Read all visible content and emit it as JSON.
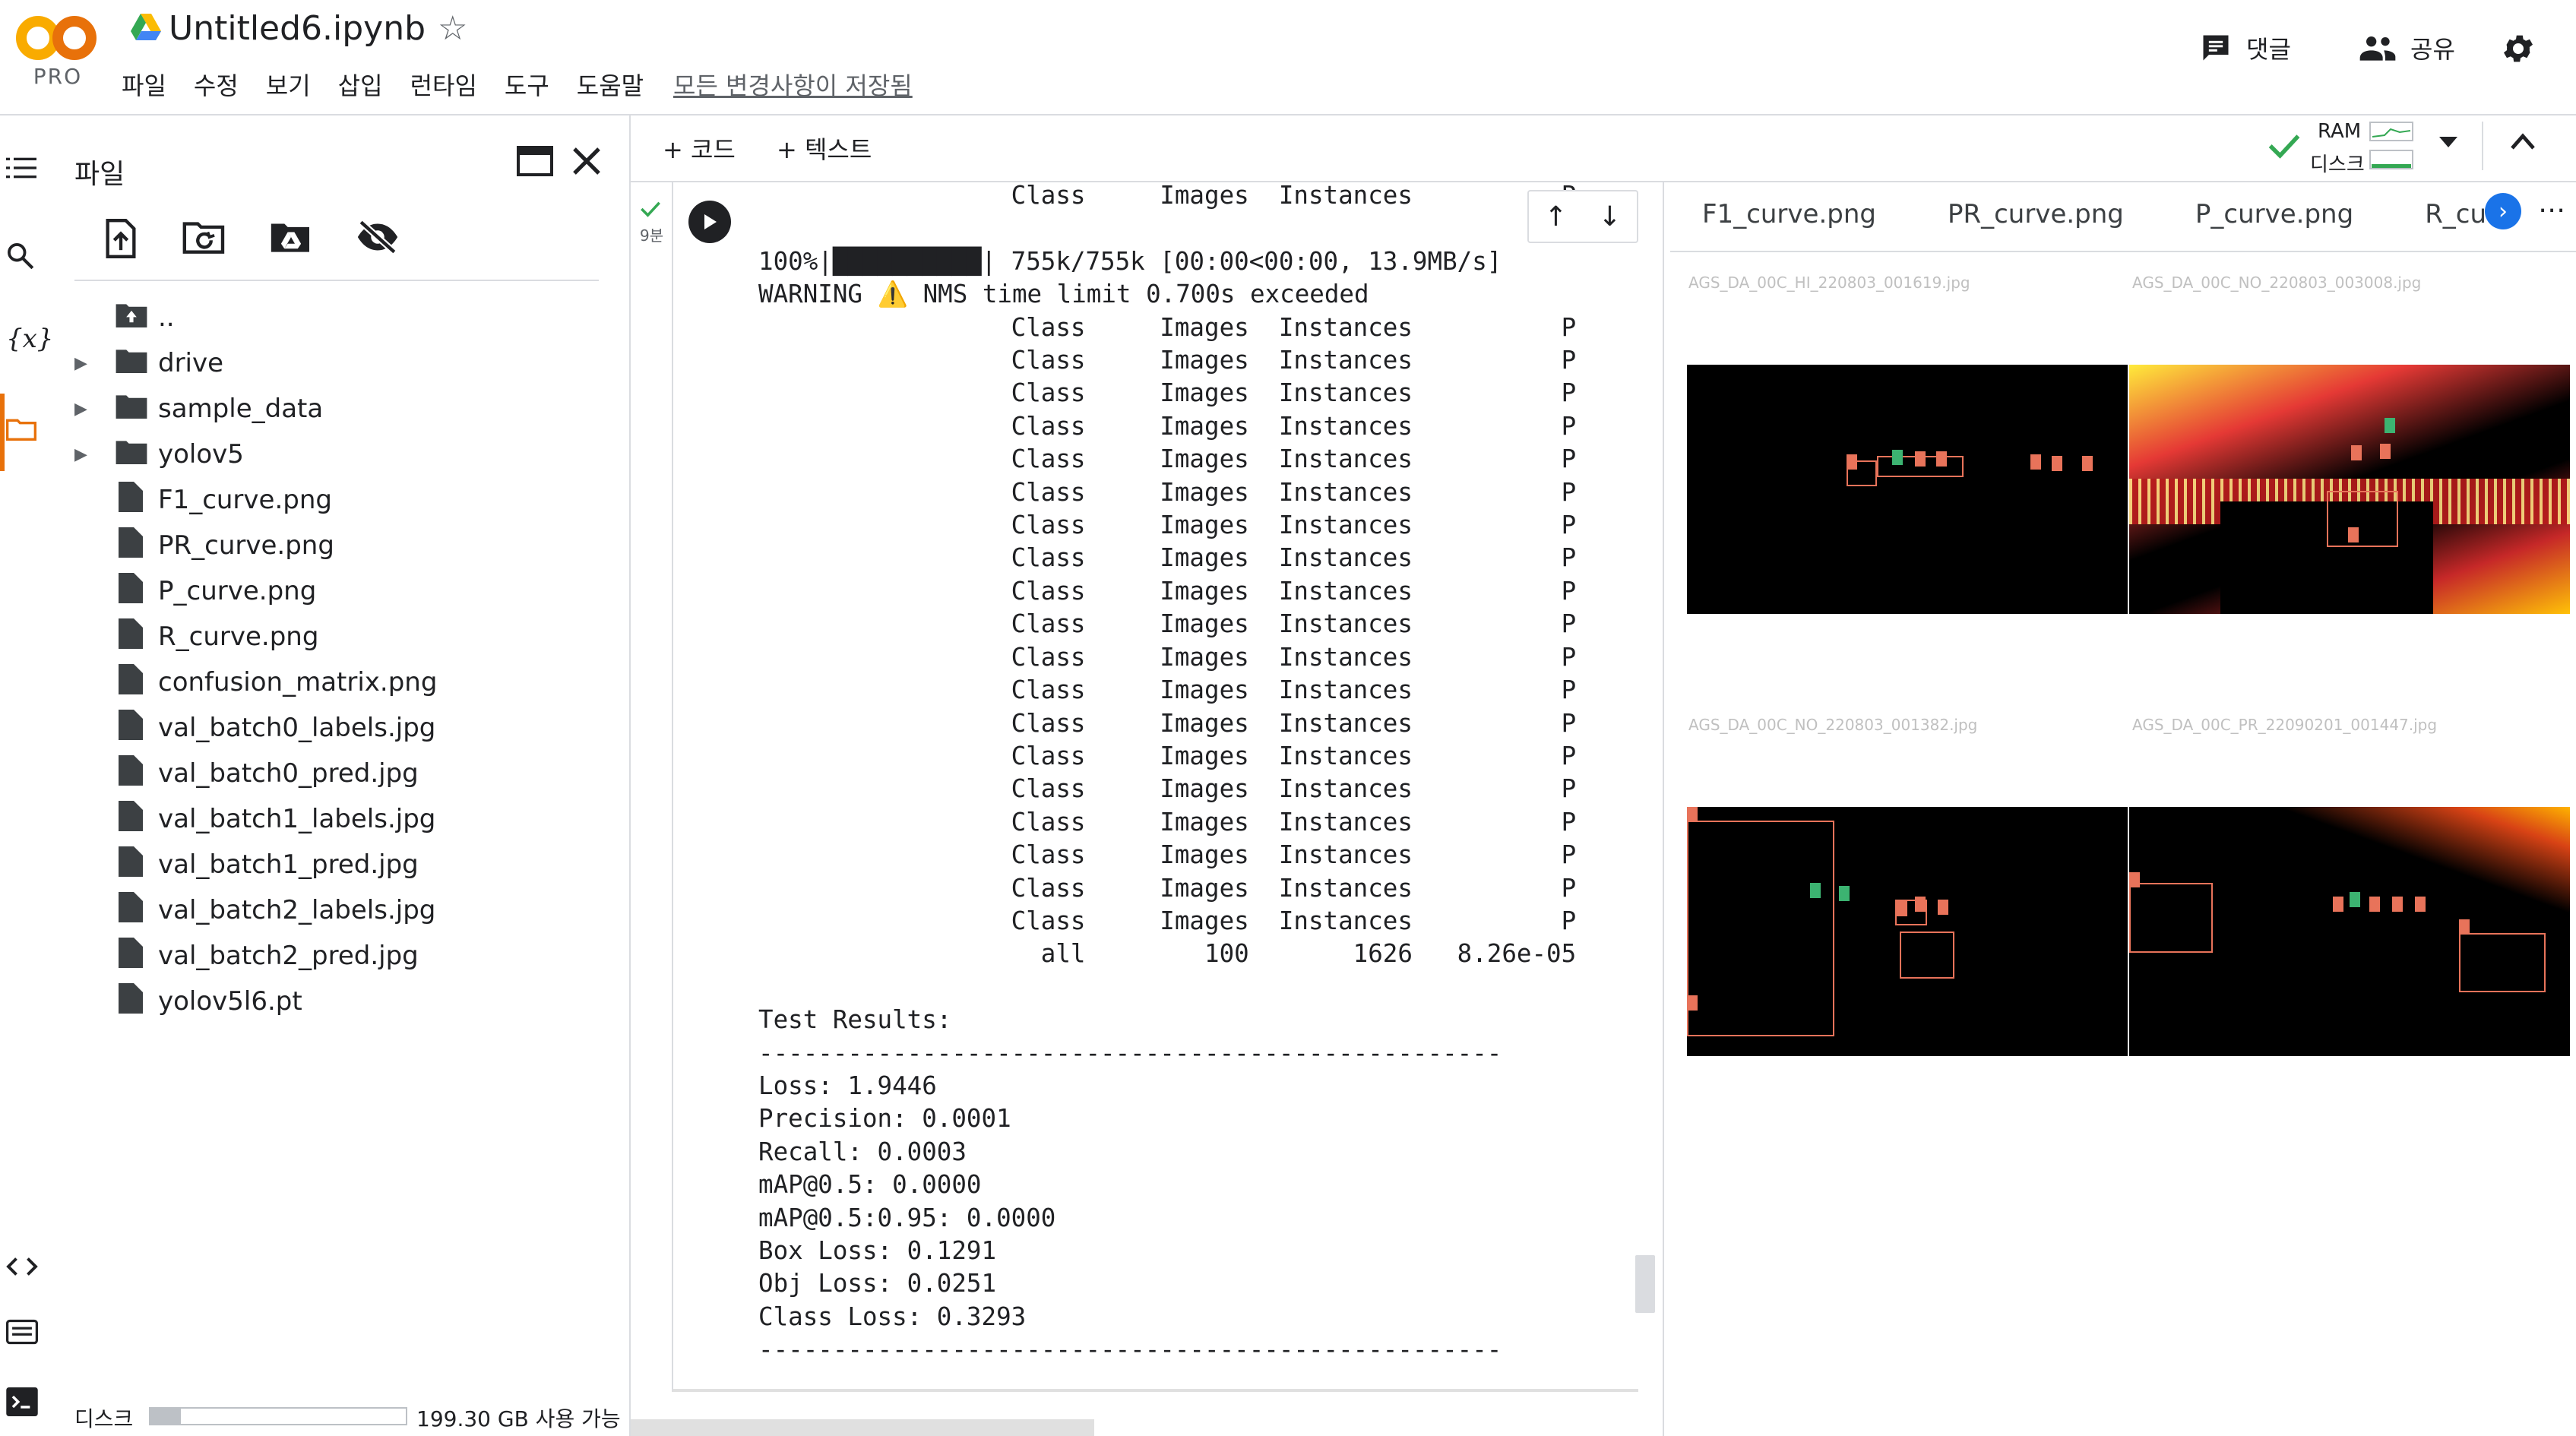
{
  "header": {
    "logo_text": "CO",
    "logo_badge": "PRO",
    "title": "Untitled6.ipynb",
    "menu": [
      "파일",
      "수정",
      "보기",
      "삽입",
      "런타임",
      "도구",
      "도움말"
    ],
    "saved_status": "모든 변경사항이 저장됨",
    "comment_label": "댓글",
    "share_label": "공유"
  },
  "files_panel": {
    "title": "파일",
    "items": [
      {
        "name": "..",
        "type": "up"
      },
      {
        "name": "drive",
        "type": "folder"
      },
      {
        "name": "sample_data",
        "type": "folder"
      },
      {
        "name": "yolov5",
        "type": "folder"
      },
      {
        "name": "F1_curve.png",
        "type": "file"
      },
      {
        "name": "PR_curve.png",
        "type": "file"
      },
      {
        "name": "P_curve.png",
        "type": "file"
      },
      {
        "name": "R_curve.png",
        "type": "file"
      },
      {
        "name": "confusion_matrix.png",
        "type": "file"
      },
      {
        "name": "val_batch0_labels.jpg",
        "type": "file"
      },
      {
        "name": "val_batch0_pred.jpg",
        "type": "file"
      },
      {
        "name": "val_batch1_labels.jpg",
        "type": "file"
      },
      {
        "name": "val_batch1_pred.jpg",
        "type": "file"
      },
      {
        "name": "val_batch2_labels.jpg",
        "type": "file"
      },
      {
        "name": "val_batch2_pred.jpg",
        "type": "file"
      },
      {
        "name": "yolov5l6.pt",
        "type": "file"
      }
    ],
    "disk_label": "디스크",
    "disk_free": "199.30 GB 사용 가능",
    "disk_used_fraction": 0.12
  },
  "toolbar": {
    "add_code": "+ 코드",
    "add_text": "+ 텍스트",
    "ram_label": "RAM",
    "disk_label": "디스크"
  },
  "cell": {
    "exec_time": "9분",
    "output_lines": [
      "                 Class     Images  Instances          P",
      "",
      "100%|██████████| 755k/755k [00:00<00:00, 13.9MB/s]",
      "WARNING ⚠️ NMS time limit 0.700s exceeded",
      "                 Class     Images  Instances          P",
      "                 Class     Images  Instances          P",
      "                 Class     Images  Instances          P",
      "                 Class     Images  Instances          P",
      "                 Class     Images  Instances          P",
      "                 Class     Images  Instances          P",
      "                 Class     Images  Instances          P",
      "                 Class     Images  Instances          P",
      "                 Class     Images  Instances          P",
      "                 Class     Images  Instances          P",
      "                 Class     Images  Instances          P",
      "                 Class     Images  Instances          P",
      "                 Class     Images  Instances          P",
      "                 Class     Images  Instances          P",
      "                 Class     Images  Instances          P",
      "                 Class     Images  Instances          P",
      "                 Class     Images  Instances          P",
      "                 Class     Images  Instances          P",
      "                 Class     Images  Instances          P",
      "                   all        100       1626   8.26e-05",
      "",
      "Test Results:",
      "--------------------------------------------------",
      "Loss: 1.9446",
      "Precision: 0.0001",
      "Recall: 0.0003",
      "mAP@0.5: 0.0000",
      "mAP@0.5:0.95: 0.0000",
      "Box Loss: 0.1291",
      "Obj Loss: 0.0251",
      "Class Loss: 0.3293",
      "--------------------------------------------------"
    ]
  },
  "viewer": {
    "tabs": [
      "F1_curve.png",
      "PR_curve.png",
      "P_curve.png",
      "R_curv"
    ],
    "images": [
      {
        "caption": "AGS_DA_00C_HI_220803_001619.jpg"
      },
      {
        "caption": "AGS_DA_00C_NO_220803_003008.jpg"
      },
      {
        "caption": "AGS_DA_00C_NO_220803_001382.jpg"
      },
      {
        "caption": "AGS_DA_00C_PR_22090201_001447.jpg"
      }
    ]
  }
}
